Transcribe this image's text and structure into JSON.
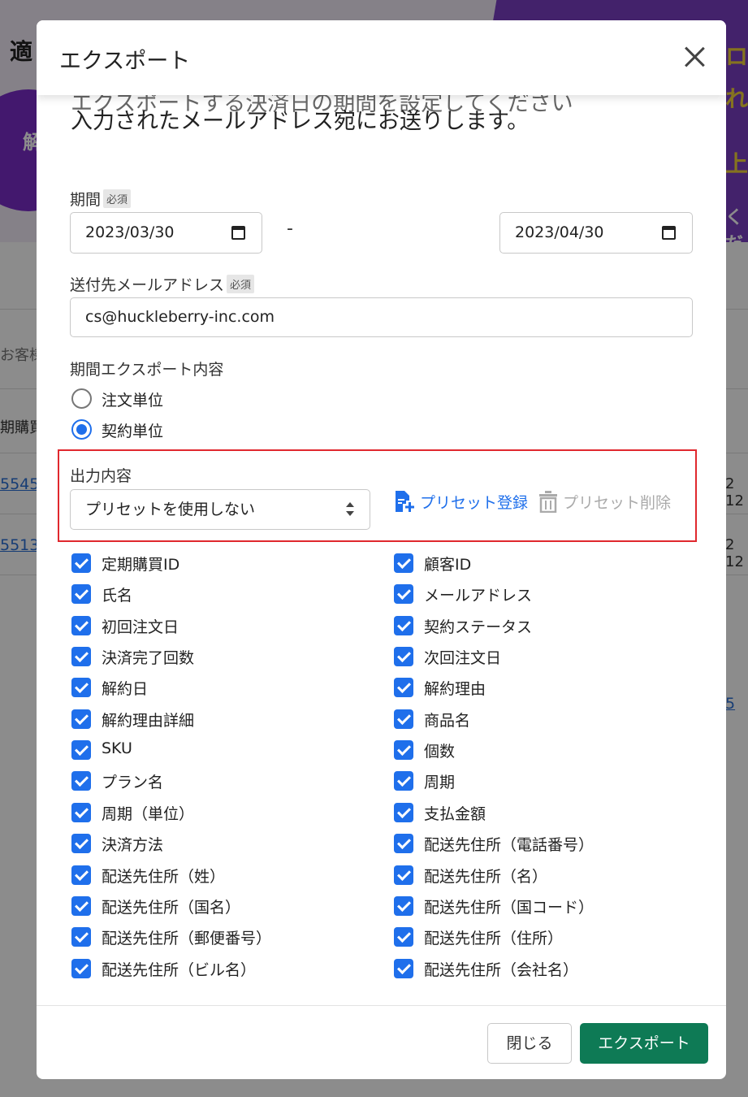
{
  "background": {
    "banner_left_text": "適",
    "banner_circle_text": "解",
    "banner_right_texts": [
      "ロ",
      "れ",
      "上",
      "く だ"
    ],
    "table_header_fragments": [
      "お客様",
      "期購買"
    ],
    "links": [
      "5545",
      "5513"
    ],
    "right_fragments": [
      "2 12",
      "2 12"
    ],
    "right_link": "5"
  },
  "modal": {
    "title": "エクスポート",
    "intro_hidden": "エクスポートする決済日の期間を設定してください",
    "intro": "入力されたメールアドレス宛にお送りします。",
    "period": {
      "label": "期間",
      "required": "必須",
      "start": "2023/03/30",
      "separator": "-",
      "end": "2023/04/30"
    },
    "email": {
      "label": "送付先メールアドレス",
      "required": "必須",
      "value": "cs@huckleberry-inc.com"
    },
    "export_content": {
      "label": "期間エクスポート内容",
      "options": [
        {
          "label": "注文単位",
          "selected": false
        },
        {
          "label": "契約単位",
          "selected": true
        }
      ]
    },
    "output": {
      "label": "出力内容",
      "preset_value": "プリセットを使用しない",
      "register_label": "プリセット登録",
      "delete_label": "プリセット削除"
    },
    "fields_left": [
      "定期購買ID",
      "氏名",
      "初回注文日",
      "決済完了回数",
      "解約日",
      "解約理由詳細",
      "SKU",
      "プラン名",
      "周期（単位）",
      "決済方法",
      "配送先住所（姓）",
      "配送先住所（国名）",
      "配送先住所（郵便番号）",
      "配送先住所（ビル名）"
    ],
    "fields_right": [
      "顧客ID",
      "メールアドレス",
      "契約ステータス",
      "次回注文日",
      "解約理由",
      "商品名",
      "個数",
      "周期",
      "支払金額",
      "配送先住所（電話番号）",
      "配送先住所（名）",
      "配送先住所（国コード）",
      "配送先住所（住所）",
      "配送先住所（会社名）"
    ],
    "buttons": {
      "close": "閉じる",
      "export": "エクスポート"
    }
  },
  "colors": {
    "accent": "#1f6feb",
    "primary_button": "#0e7a55",
    "highlight_border": "#e0282e"
  }
}
